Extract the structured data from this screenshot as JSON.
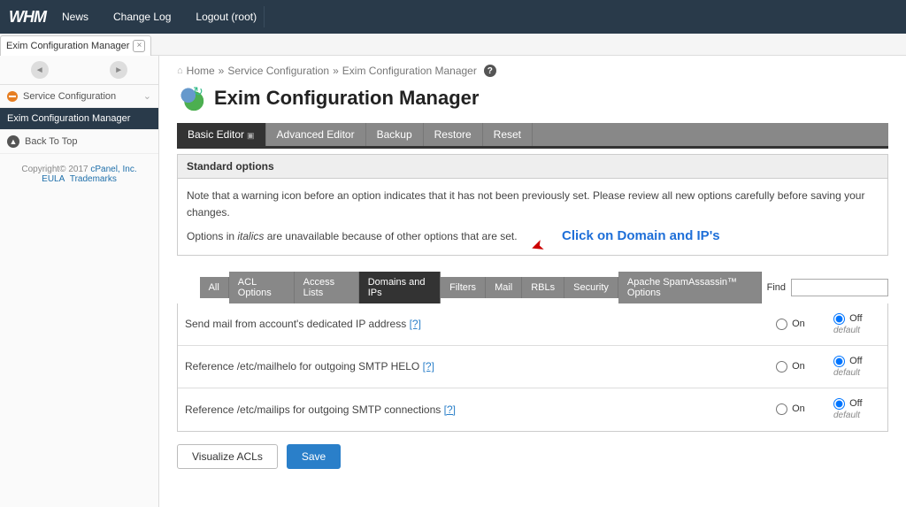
{
  "topbar": {
    "logo": "WHM",
    "nav": [
      "News",
      "Change Log",
      "Logout (root)"
    ]
  },
  "open_tab": {
    "label": "Exim Configuration Manager"
  },
  "sidebar": {
    "items": [
      {
        "label": "Service Configuration"
      },
      {
        "label": "Exim Configuration Manager"
      },
      {
        "label": "Back To Top"
      }
    ],
    "footer": {
      "copyright": "Copyright© 2017 ",
      "cpanel": "cPanel, Inc.",
      "eula": "EULA",
      "trademarks": "Trademarks"
    }
  },
  "breadcrumb": {
    "home": "Home",
    "sep": "»",
    "l2": "Service Configuration",
    "l3": "Exim Configuration Manager"
  },
  "page": {
    "title": "Exim Configuration Manager"
  },
  "editor_tabs": [
    "Basic Editor",
    "Advanced Editor",
    "Backup",
    "Restore",
    "Reset"
  ],
  "panel": {
    "heading": "Standard options",
    "note1": "Note that a warning icon before an option indicates that it has not been previously set. Please review all new options carefully before saving your changes.",
    "note2a": "Options in ",
    "note2i": "italics",
    "note2b": " are unavailable because of other options that are set."
  },
  "annotation": {
    "text": "Click on Domain and IP's"
  },
  "opt_tabs": [
    "All",
    "ACL Options",
    "Access Lists",
    "Domains and IPs",
    "Filters",
    "Mail",
    "RBLs",
    "Security",
    "Apache SpamAssassin™ Options"
  ],
  "opt_tabs_active": 3,
  "find": {
    "label": "Find",
    "value": ""
  },
  "options": [
    {
      "desc": "Send mail from account's dedicated IP address",
      "q": "[?]",
      "selected": "off",
      "default": "default"
    },
    {
      "desc": "Reference /etc/mailhelo for outgoing SMTP HELO",
      "q": "[?]",
      "selected": "off",
      "default": "default"
    },
    {
      "desc": "Reference /etc/mailips for outgoing SMTP connections",
      "q": "[?]",
      "selected": "off",
      "default": "default"
    }
  ],
  "radios": {
    "on": "On",
    "off": "Off"
  },
  "buttons": {
    "visualize": "Visualize ACLs",
    "save": "Save"
  }
}
